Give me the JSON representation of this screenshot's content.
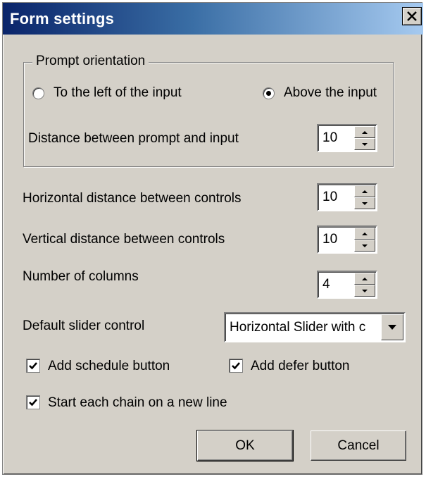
{
  "window": {
    "title": "Form settings",
    "close_glyph": "✕",
    "close_icon": "close-icon"
  },
  "prompt_orientation": {
    "legend": "Prompt orientation",
    "options": [
      {
        "label": "To the left of the input",
        "selected": false
      },
      {
        "label": "Above the input",
        "selected": true
      }
    ],
    "distance_label": "Distance between prompt and input",
    "distance_value": "10"
  },
  "fields": {
    "horizontal_label": "Horizontal distance between controls",
    "horizontal_value": "10",
    "vertical_label": "Vertical distance between controls",
    "vertical_value": "10",
    "columns_label": "Number of columns",
    "columns_value": "4",
    "slider_label": "Default slider control",
    "slider_value": "Horizontal Slider with c"
  },
  "checkboxes": {
    "schedule": {
      "label": "Add schedule button",
      "checked": true
    },
    "defer": {
      "label": "Add defer button",
      "checked": true
    },
    "chain": {
      "label": "Start each chain on a new line",
      "checked": true
    }
  },
  "buttons": {
    "ok": "OK",
    "cancel": "Cancel"
  },
  "colors": {
    "dialog_bg": "#d4d0c8",
    "title_start": "#0a246a",
    "title_end": "#a6caf0"
  }
}
